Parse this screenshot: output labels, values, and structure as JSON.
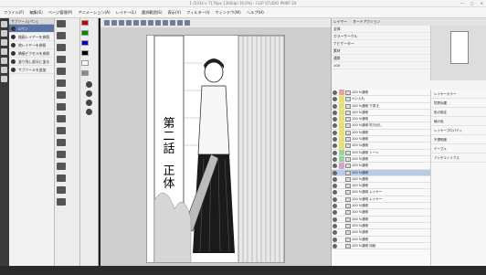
{
  "title": "1 (5334 x 7176px 1366dpi 16.6%) - CLIP STUDIO PAINT EX",
  "menu": [
    "ファイル(F)",
    "編集(E)",
    "ページ管理(P)",
    "アニメーション(A)",
    "レイヤー(L)",
    "選択範囲(S)",
    "表示(V)",
    "フィルター(I)",
    "ウィンドウ(W)",
    "ヘルプ(H)"
  ],
  "subtool": {
    "header": "サブツール[ペン]",
    "items": [
      "Gペン",
      "丸ペン",
      "カブラペン",
      "ペン[ベクター]",
      "筆ペン"
    ],
    "extra1": "描画レイヤーを参照",
    "extra2": "他レイヤーを参照",
    "extra3": "隣接ピクセルを参照",
    "extra4": "塗り残し部分に塗る",
    "add": "サブツールを追加"
  },
  "canvas": {
    "vertical_text": [
      "第",
      "二",
      "話",
      "正",
      "体"
    ]
  },
  "rightpanel": {
    "tabs": [
      "レイヤー",
      "オートアクション"
    ],
    "labels": [
      "全体",
      "カラーサークル",
      "ナビゲーター",
      "素材"
    ],
    "props": [
      "通常",
      "100",
      "不透明度"
    ],
    "layers": [
      "100 %通常",
      "ペン入れ",
      "100 %通常 下書き",
      "100 %通常",
      "100 %通常",
      "100 %通常 吹き出し",
      "100 %通常",
      "100 %通常",
      "100 %通常",
      "100 %通常 トーン",
      "100 %通常",
      "100 %通常",
      "100 %通常",
      "100 %通常",
      "100 %通常",
      "100 %通常 レイヤー",
      "100 %通常 レイヤー",
      "100 %通常",
      "100 %通常",
      "100 %通常",
      "100 %通常",
      "100 %通常",
      "100 %通常",
      "100 %通常 用紙"
    ],
    "side": [
      "レイヤーカラー",
      "境界効果",
      "色の設定",
      "線の色",
      "レイヤープロパティ",
      "不透明度",
      "テーブル",
      "アンチエイリアス"
    ]
  }
}
